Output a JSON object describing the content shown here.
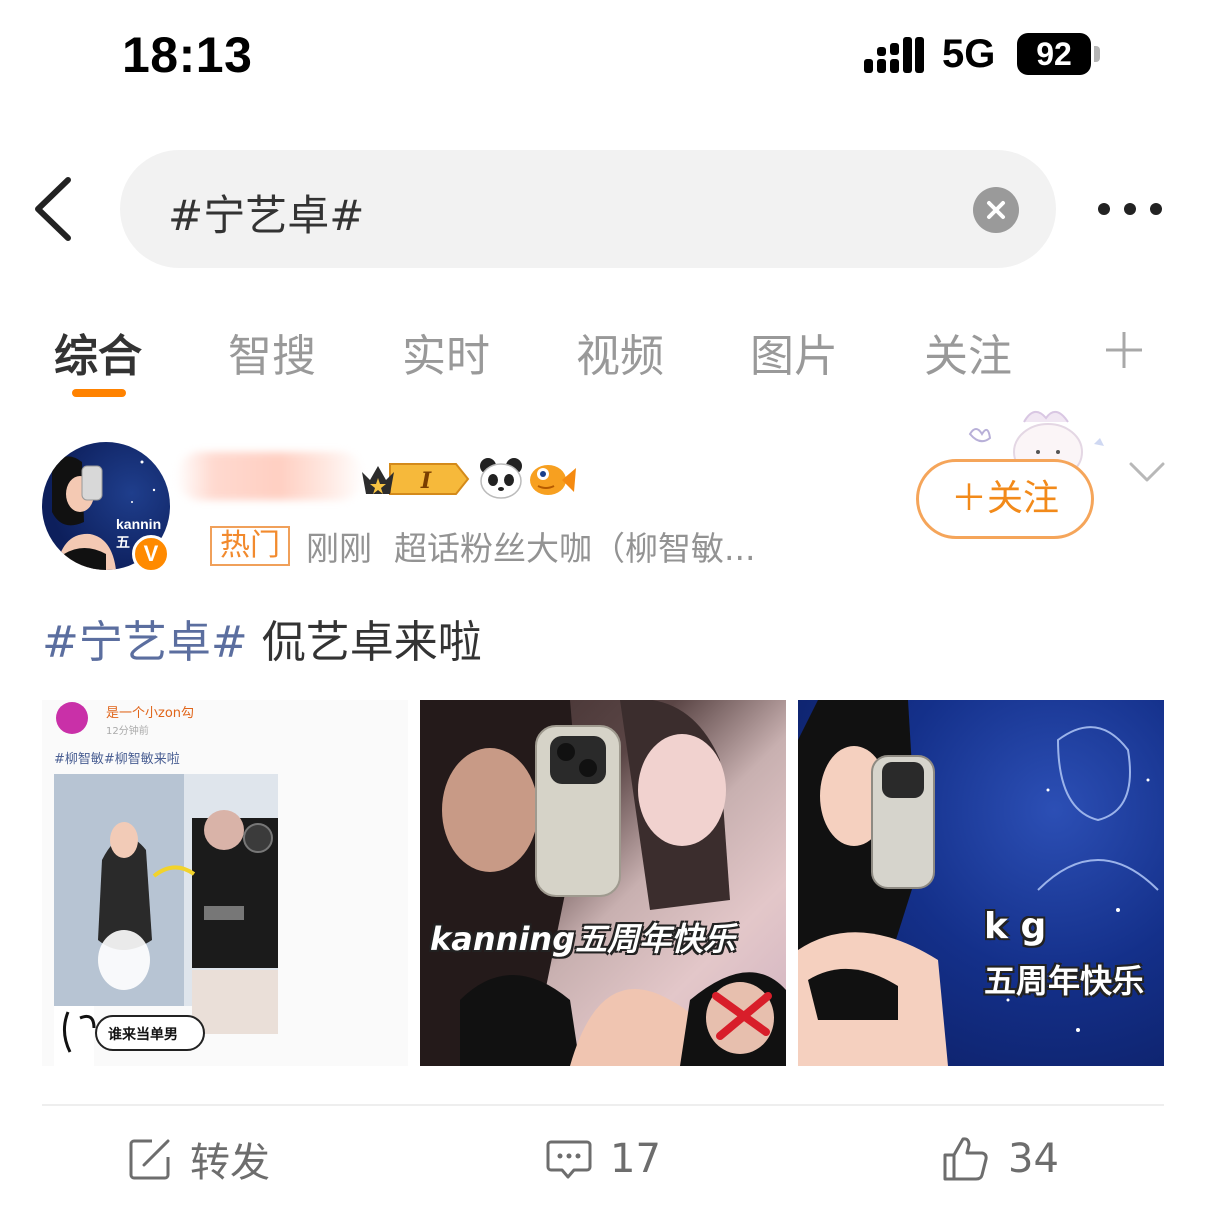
{
  "status_bar": {
    "time": "18:13",
    "network": "5G",
    "battery": "92"
  },
  "search": {
    "query": "#宁艺卓#"
  },
  "tabs": [
    {
      "label": "综合",
      "active": true
    },
    {
      "label": "智搜"
    },
    {
      "label": "实时"
    },
    {
      "label": "视频"
    },
    {
      "label": "图片"
    },
    {
      "label": "关注"
    }
  ],
  "post": {
    "avatar_text": "kannin 五",
    "vip_level": "I",
    "hot_tag": "热门",
    "time": "刚刚",
    "source": "超话粉丝大咖（柳智敏...",
    "follow_label": "＋关注",
    "topic": "#宁艺卓#",
    "text": " 侃艺卓来啦",
    "images": [
      {
        "header_name": "是一个小zon勾",
        "header_time": "12分钟前",
        "header_tags": "#柳智敏#柳智敏来啦",
        "bubble_text": "谁来当单男"
      },
      {
        "caption": "kanning五周年快乐"
      },
      {
        "caption_top": "k g",
        "caption_bottom": "五周年快乐"
      }
    ],
    "actions": {
      "repost_label": "转发",
      "comment_count": "17",
      "like_count": "34"
    }
  },
  "colors": {
    "accent": "#ff8200",
    "topic": "#5b6e9f",
    "follow": "#f28a1a"
  }
}
